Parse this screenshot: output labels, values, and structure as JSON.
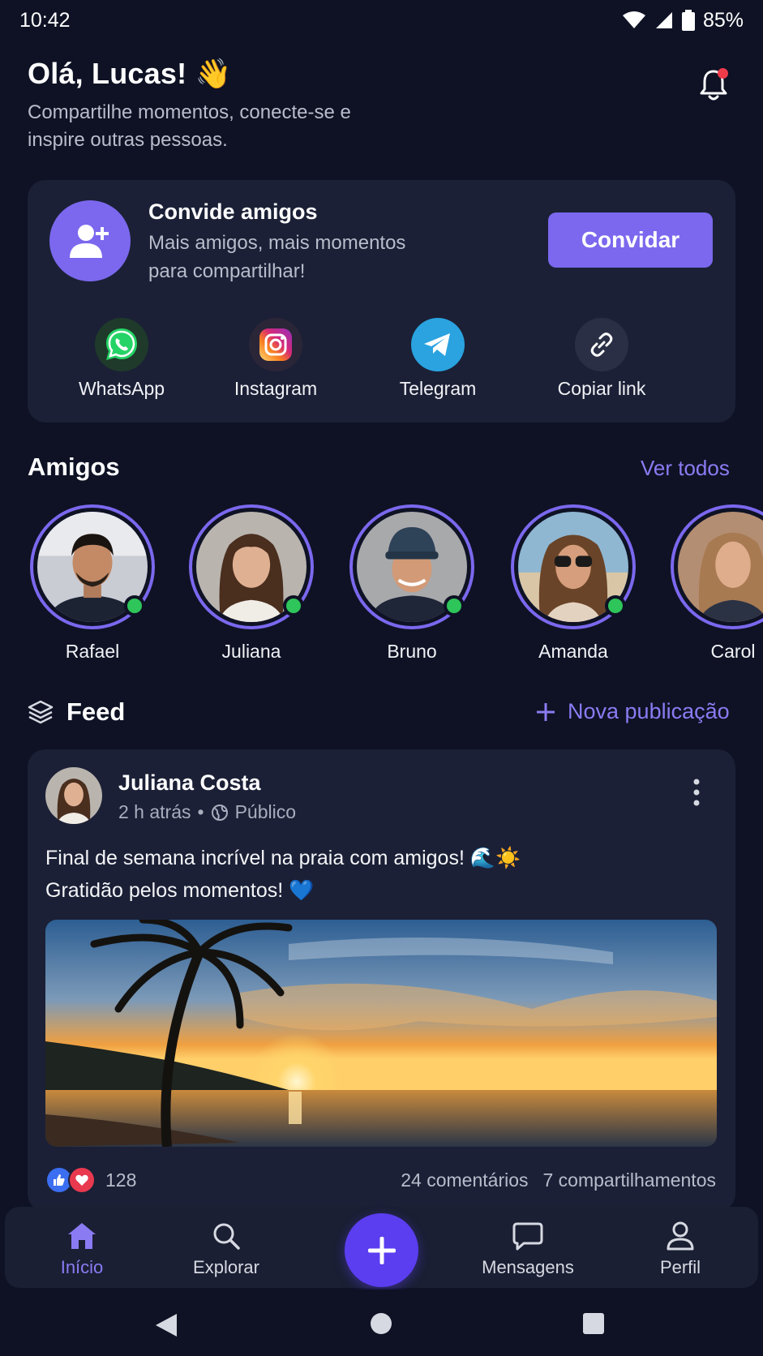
{
  "status_bar": {
    "time": "10:42",
    "battery": "85%"
  },
  "header": {
    "greeting": "Olá, Lucas! 👋",
    "subtitle": "Compartilhe momentos, conecte-se e inspire outras pessoas."
  },
  "invite": {
    "title": "Convide amigos",
    "subtitle": "Mais amigos, mais momentos para compartilhar!",
    "button_label": "Convidar",
    "share_options": [
      {
        "label": "WhatsApp",
        "icon": "whatsapp-icon",
        "color": "#25d366"
      },
      {
        "label": "Instagram",
        "icon": "instagram-icon",
        "color": "#dd2a7b"
      },
      {
        "label": "Telegram",
        "icon": "telegram-icon",
        "color": "#2aa3e0"
      },
      {
        "label": "Copiar link",
        "icon": "link-icon",
        "color": "#2a2f45"
      }
    ]
  },
  "friends": {
    "title": "Amigos",
    "see_all": "Ver todos",
    "items": [
      {
        "name": "Rafael",
        "online": true
      },
      {
        "name": "Juliana",
        "online": true
      },
      {
        "name": "Bruno",
        "online": true
      },
      {
        "name": "Amanda",
        "online": true
      },
      {
        "name": "Carol",
        "online": false
      }
    ]
  },
  "feed": {
    "title": "Feed",
    "new_post": "Nova publicação",
    "post": {
      "author": "Juliana Costa",
      "time": "2 h atrás",
      "visibility": "Público",
      "text_line1": "Final de semana incrível na praia com amigos! 🌊☀️",
      "text_line2": "Gratidão pelos momentos! 💙",
      "reactions_count": "128",
      "comments": "24 comentários",
      "shares": "7 compartilhamentos"
    }
  },
  "bottom_nav": {
    "items": [
      {
        "label": "Início",
        "icon": "home-icon",
        "active": true
      },
      {
        "label": "Explorar",
        "icon": "search-icon",
        "active": false
      },
      {
        "label": "Mensagens",
        "icon": "chat-icon",
        "active": false
      },
      {
        "label": "Perfil",
        "icon": "profile-icon",
        "active": false
      }
    ]
  },
  "colors": {
    "background": "#0e1224",
    "card": "#1b2036",
    "accent": "#7b68ee",
    "online": "#2ec55a",
    "notification": "#ef3b4a"
  }
}
